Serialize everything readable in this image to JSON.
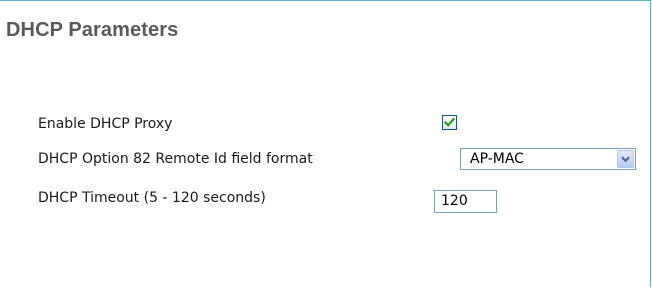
{
  "panel": {
    "title": "DHCP Parameters"
  },
  "fields": {
    "enable_proxy": {
      "label": "Enable DHCP Proxy",
      "checked": true
    },
    "option82": {
      "label": "DHCP Option 82 Remote Id field format",
      "selected": "AP-MAC"
    },
    "timeout": {
      "label": "DHCP Timeout (5 - 120 seconds)",
      "value": "120"
    }
  },
  "colors": {
    "border_accent": "#5cb0c9",
    "title_text": "#5a5a5a",
    "check_mark": "#21a121"
  },
  "icons": {
    "checkbox": "checkmark-icon",
    "dropdown": "chevron-down-icon"
  }
}
